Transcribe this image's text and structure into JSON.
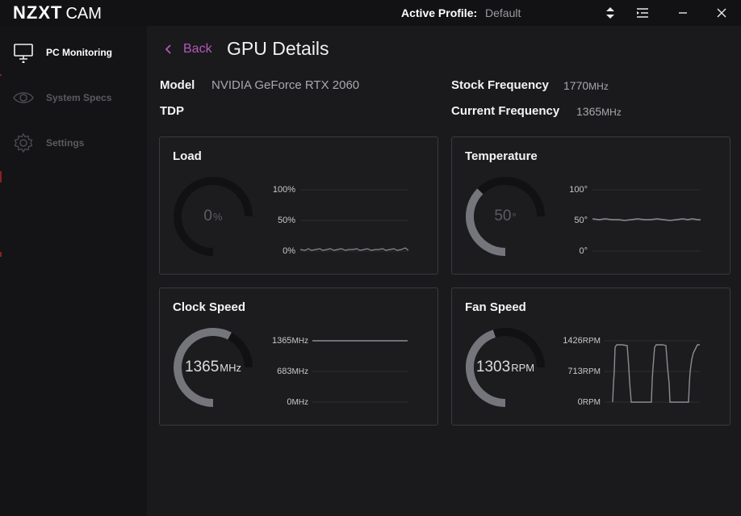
{
  "app": {
    "logo_main": "NZXT",
    "logo_sub": "CAM",
    "profile_label": "Active Profile:",
    "profile_value": "Default"
  },
  "sidebar": {
    "items": [
      {
        "label": "PC Monitoring",
        "icon": "monitor-icon",
        "active": true
      },
      {
        "label": "System Specs",
        "icon": "eye-icon",
        "active": false
      },
      {
        "label": "Settings",
        "icon": "gear-icon",
        "active": false
      }
    ]
  },
  "page": {
    "back_label": "Back",
    "title": "GPU Details"
  },
  "specs": {
    "model_label": "Model",
    "model_value": "NVIDIA GeForce RTX 2060",
    "tdp_label": "TDP",
    "stock_label": "Stock Frequency",
    "stock_value": "1770",
    "stock_unit": "MHz",
    "current_label": "Current Frequency",
    "current_value": "1365",
    "current_unit": "MHz"
  },
  "cards": {
    "load": {
      "title": "Load",
      "value": "0",
      "unit": "%",
      "fraction": 0.0,
      "axis": [
        {
          "value": "100",
          "unit": "%"
        },
        {
          "value": "50",
          "unit": "%"
        },
        {
          "value": "0",
          "unit": "%"
        }
      ]
    },
    "temperature": {
      "title": "Temperature",
      "value": "50",
      "unit": "°",
      "fraction": 0.5,
      "axis": [
        {
          "value": "100",
          "unit": "°"
        },
        {
          "value": "50",
          "unit": "°"
        },
        {
          "value": "0",
          "unit": "°"
        }
      ]
    },
    "clock": {
      "title": "Clock Speed",
      "value": "1365",
      "unit": "MHz",
      "fraction": 0.77,
      "axis": [
        {
          "value": "1365",
          "unit": "MHz"
        },
        {
          "value": "683",
          "unit": "MHz"
        },
        {
          "value": "0",
          "unit": "MHz"
        }
      ]
    },
    "fan": {
      "title": "Fan Speed",
      "value": "1303",
      "unit": "RPM",
      "fraction": 0.6,
      "axis": [
        {
          "value": "1426",
          "unit": "RPM"
        },
        {
          "value": "713",
          "unit": "RPM"
        },
        {
          "value": "0",
          "unit": "RPM"
        }
      ]
    }
  },
  "colors": {
    "accent": "#b35ab8",
    "gauge_fill": "#75757c",
    "gauge_track": "#111113",
    "line": "#8c8c92"
  }
}
